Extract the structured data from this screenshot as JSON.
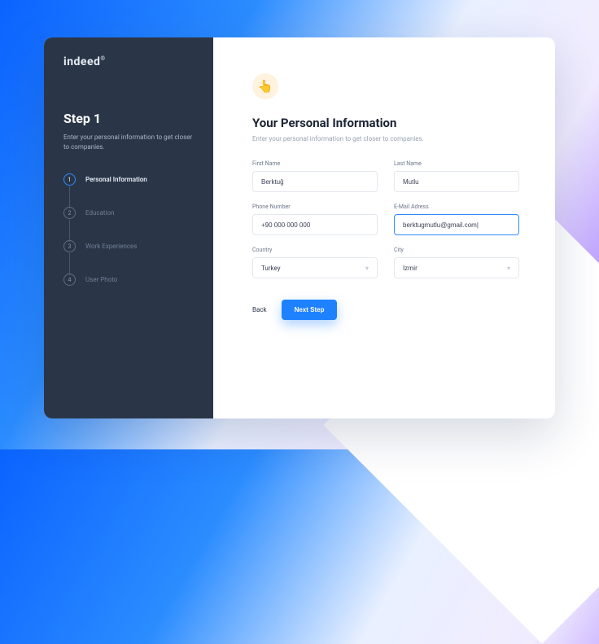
{
  "brand": "indeed",
  "sidebar": {
    "title": "Step 1",
    "subtitle": "Enter your personal information to get closer to companies.",
    "steps": [
      {
        "num": "1",
        "label": "Personal Information"
      },
      {
        "num": "2",
        "label": "Education"
      },
      {
        "num": "3",
        "label": "Work Experiences"
      },
      {
        "num": "4",
        "label": "User Photo"
      }
    ]
  },
  "form": {
    "icon": "👆",
    "title": "Your Personal Information",
    "subtitle": "Enter your personal information to get closer to companies.",
    "fields": {
      "firstName": {
        "label": "First Name",
        "value": "Berktuğ"
      },
      "lastName": {
        "label": "Last Name",
        "value": "Mutlu"
      },
      "phone": {
        "label": "Phone Number",
        "value": "+90 000 000 000"
      },
      "email": {
        "label": "E-Mail Adress",
        "value": "berktugmutlu@gmail.com|"
      },
      "country": {
        "label": "Country",
        "value": "Turkey"
      },
      "city": {
        "label": "City",
        "value": "Izmir"
      }
    },
    "actions": {
      "back": "Back",
      "next": "Next Step"
    }
  }
}
